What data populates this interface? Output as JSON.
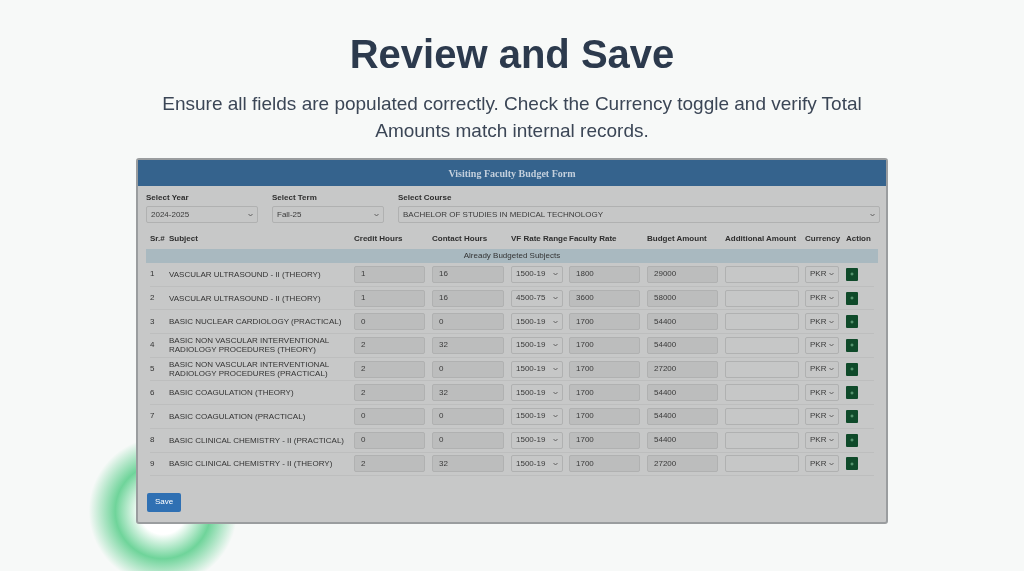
{
  "title": "Review and Save",
  "subtitle": "Ensure all fields are populated correctly. Check the Currency toggle and verify Total Amounts match internal records.",
  "form": {
    "title": "Visiting Faculty Budget Form",
    "filters": [
      {
        "label": "Select Year",
        "value": "2024-2025"
      },
      {
        "label": "Select Term",
        "value": "Fall-25"
      },
      {
        "label": "Select Course",
        "value": "BACHELOR OF STUDIES IN MEDICAL TECHNOLOGY"
      }
    ],
    "columns": [
      "Sr.#",
      "Subject",
      "Credit Hours",
      "Contact Hours",
      "VF Rate Range",
      "Faculty Rate",
      "Budget Amount",
      "Additional Amount",
      "Currency",
      "Action"
    ],
    "group_label": "Already Budgeted Subjects",
    "rows": [
      {
        "sr": "1",
        "subject": "VASCULAR ULTRASOUND - II (THEORY)",
        "credit_hours": "1",
        "contact_hours": "16",
        "vf_rate_range": "1500-19",
        "faculty_rate": "1800",
        "budget_amount": "29000",
        "currency": "PKR"
      },
      {
        "sr": "2",
        "subject": "VASCULAR ULTRASOUND - II (THEORY)",
        "credit_hours": "1",
        "contact_hours": "16",
        "vf_rate_range": "4500-75",
        "faculty_rate": "3600",
        "budget_amount": "58000",
        "currency": "PKR"
      },
      {
        "sr": "3",
        "subject": "BASIC NUCLEAR CARDIOLOGY (PRACTICAL)",
        "credit_hours": "0",
        "contact_hours": "0",
        "vf_rate_range": "1500-19",
        "faculty_rate": "1700",
        "budget_amount": "54400",
        "currency": "PKR"
      },
      {
        "sr": "4",
        "subject": "BASIC NON VASCULAR INTERVENTIONAL RADIOLOGY PROCEDURES (THEORY)",
        "credit_hours": "2",
        "contact_hours": "32",
        "vf_rate_range": "1500-19",
        "faculty_rate": "1700",
        "budget_amount": "54400",
        "currency": "PKR"
      },
      {
        "sr": "5",
        "subject": "BASIC NON VASCULAR INTERVENTIONAL RADIOLOGY PROCEDURES (PRACTICAL)",
        "credit_hours": "2",
        "contact_hours": "0",
        "vf_rate_range": "1500-19",
        "faculty_rate": "1700",
        "budget_amount": "27200",
        "currency": "PKR"
      },
      {
        "sr": "6",
        "subject": "BASIC COAGULATION (THEORY)",
        "credit_hours": "2",
        "contact_hours": "32",
        "vf_rate_range": "1500-19",
        "faculty_rate": "1700",
        "budget_amount": "54400",
        "currency": "PKR"
      },
      {
        "sr": "7",
        "subject": "BASIC COAGULATION (PRACTICAL)",
        "credit_hours": "0",
        "contact_hours": "0",
        "vf_rate_range": "1500-19",
        "faculty_rate": "1700",
        "budget_amount": "54400",
        "currency": "PKR"
      },
      {
        "sr": "8",
        "subject": "BASIC CLINICAL CHEMISTRY - II (PRACTICAL)",
        "credit_hours": "0",
        "contact_hours": "0",
        "vf_rate_range": "1500-19",
        "faculty_rate": "1700",
        "budget_amount": "54400",
        "currency": "PKR"
      },
      {
        "sr": "9",
        "subject": "BASIC CLINICAL CHEMISTRY - II (THEORY)",
        "credit_hours": "2",
        "contact_hours": "32",
        "vf_rate_range": "1500-19",
        "faculty_rate": "1700",
        "budget_amount": "27200",
        "currency": "PKR"
      }
    ],
    "save_button": "Save"
  }
}
